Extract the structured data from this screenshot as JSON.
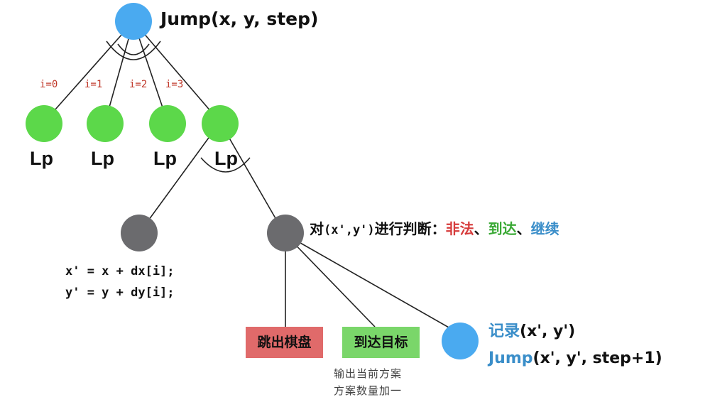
{
  "root": {
    "title": "Jump(x, y, step)"
  },
  "edge_labels": [
    "i=0",
    "i=1",
    "i=2",
    "i=3"
  ],
  "children": [
    "Lp",
    "Lp",
    "Lp",
    "Lp"
  ],
  "code": {
    "line1": "x' = x + dx[i];",
    "line2": "y' = y + dy[i];"
  },
  "judge": {
    "prefix": "对",
    "coords": "(x',y')",
    "middle": "进行判断：",
    "illegal": "非法",
    "sep1": "、",
    "reach": "到达",
    "sep2": "、",
    "cont": "继续"
  },
  "outcomes": {
    "out_of_board": "跳出棋盘",
    "reach_target": "到达目标",
    "note_line1": "输出当前方案",
    "note_line2": "方案数量加一",
    "record_prefix": "记录",
    "record_coords": "(x', y')",
    "recurse": "Jump",
    "recurse_args": "(x', y', step+1)"
  },
  "colors": {
    "blue_node": "#4aaaf0",
    "green_node": "#5cd84a",
    "gray_node": "#6b6b6e",
    "illegal": "#d63b3b",
    "reach": "#3aa935",
    "continue": "#3a8ec9",
    "box_red": "#e06a6a",
    "box_green": "#7ad66a"
  }
}
